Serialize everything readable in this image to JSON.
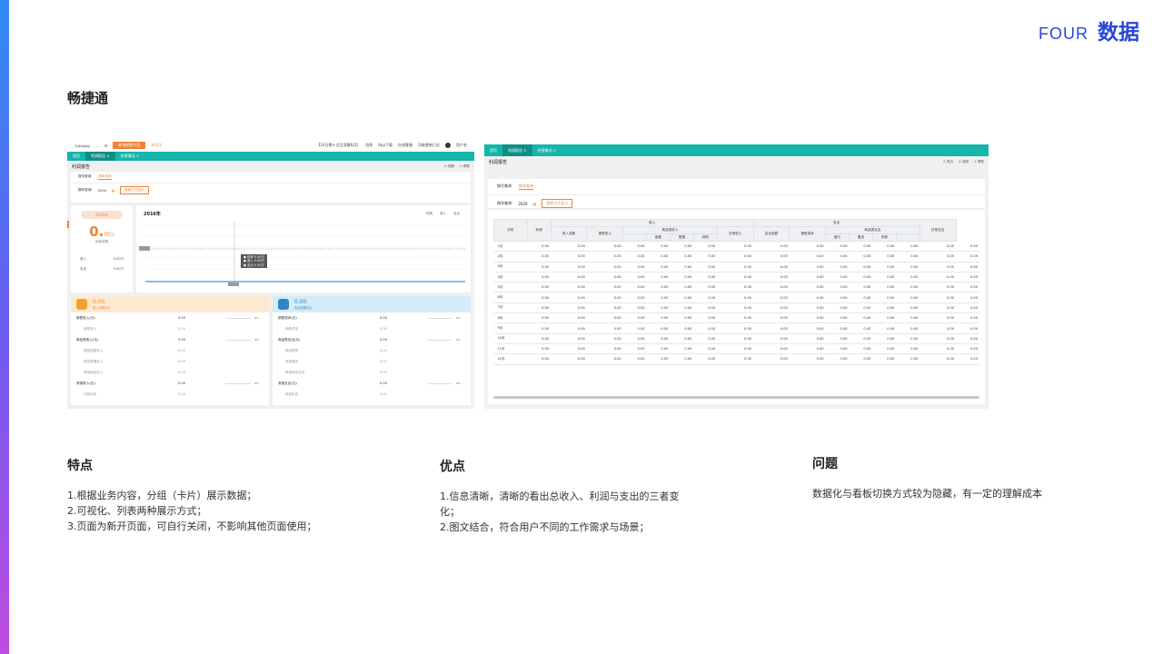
{
  "section": {
    "number": "FOUR",
    "title": "数据"
  },
  "product_name": "畅捷通",
  "shot1": {
    "topbar": {
      "company": "Tplink(tw)",
      "orange_button": "新增经营方案",
      "link": "本位企",
      "items": [
        "【24日晚十点至凌晨6点】",
        "消息",
        "App下载",
        "在线客服",
        "功能更新日志"
      ],
      "user": "用户名"
    },
    "tabs": [
      "首页",
      "利润报告 ×",
      "经营情况 ×"
    ],
    "page_title": "利润报告",
    "tools": [
      "⊙ 视频",
      "⊙ 帮助"
    ],
    "subtabs": [
      "按月查询",
      "按年查询"
    ],
    "filter_label": "报年查询:",
    "filter_year": "2016",
    "filter_button": "表格方式显示",
    "summary": {
      "year_pill": "2016年",
      "value": "0.",
      "value_small": "00",
      "unit": "万",
      "label": "利润总额",
      "income_label": "收入",
      "income_value": "0.00万",
      "expense_label": "支出",
      "expense_value": "0.00万"
    },
    "chart": {
      "title": "2016年",
      "legend": [
        "利润",
        "收入",
        "支出"
      ],
      "tooltip": [
        "● 利润 0.00万",
        "● 收入 0.00万",
        "● 支出 0.00万"
      ]
    },
    "income_panel": {
      "value": "0.00",
      "sub": "收入总额(元)",
      "rows": [
        {
          "name": "销售收入(元)",
          "value": "0.00",
          "pct": "0%",
          "sub": false
        },
        {
          "name": "销售收入",
          "value": "0.00",
          "sub": true
        },
        {
          "name": "商品类收入(元)",
          "value": "0.00",
          "pct": "0%",
          "sub": false
        },
        {
          "name": "商品盘盈收入",
          "value": "0.00",
          "sub": true
        },
        {
          "name": "商品受赠收入",
          "value": "0.00",
          "sub": true
        },
        {
          "name": "其他商品收入",
          "value": "0.00",
          "sub": true
        },
        {
          "name": "其他收入(元)",
          "value": "0.00",
          "pct": "0%",
          "sub": false
        },
        {
          "name": "付款折扣",
          "value": "0.00",
          "sub": true
        }
      ]
    },
    "expense_panel": {
      "value": "0.00",
      "sub": "支出总额(元)",
      "rows": [
        {
          "name": "销售成本(元)",
          "value": "0.00",
          "pct": "0%",
          "sub": false
        },
        {
          "name": "销售成本",
          "value": "0.00",
          "sub": true
        },
        {
          "name": "商品类支出(元)",
          "value": "0.00",
          "pct": "0%",
          "sub": false
        },
        {
          "name": "商品报损",
          "value": "0.00",
          "sub": true
        },
        {
          "name": "商品赠出",
          "value": "0.00",
          "sub": true
        },
        {
          "name": "其他商品支出",
          "value": "0.00",
          "sub": true
        },
        {
          "name": "其他支出(元)",
          "value": "0.00",
          "pct": "0%",
          "sub": false
        },
        {
          "name": "收款折扣",
          "value": "0.00",
          "sub": true
        }
      ]
    }
  },
  "shot2": {
    "tabs": [
      "首页",
      "利润报告 ×",
      "经营情况 ×"
    ],
    "page_title": "利润报告",
    "tools": [
      "⊙ 导出",
      "⊙ 视频",
      "⊙ 帮助"
    ],
    "subtabs": [
      "按月查询",
      "按年查询"
    ],
    "filter_label": "按年查询:",
    "filter_year": "2020",
    "filter_button": "图表方式显示",
    "table": {
      "h_month": "月份",
      "h_profit": "利润",
      "h_income": "收入",
      "h_expense": "支出",
      "h_income_total": "收入总额",
      "h_sales_income": "销售收入",
      "h_goods_income": "商品类收入",
      "h_daily_income": "日常收入",
      "h_surplus": "盘盈",
      "h_gift_in": "受赠",
      "h_other": "其他",
      "h_expense_total": "支出总额",
      "h_sales_cost": "销售成本",
      "h_goods_expense": "商品类支出",
      "h_daily_expense": "日常支出",
      "h_loss": "盘亏",
      "h_gift_out": "赠送",
      "h_other2": "其他",
      "months": [
        "1月",
        "2月",
        "3月",
        "4月",
        "5月",
        "6月",
        "7月",
        "8月",
        "9月",
        "10月",
        "11月",
        "12月"
      ],
      "cell": "0.00"
    }
  },
  "features": {
    "title": "特点",
    "items": [
      "1.根据业务内容，分组（卡片）展示数据；",
      "2.可视化、列表两种展示方式；",
      "3.页面为新开页面，可自行关闭，不影响其他页面使用；"
    ]
  },
  "advantages": {
    "title": "优点",
    "items": [
      "1.信息清晰，清晰的看出总收入、利润与支出的三者变化；",
      "2.图文结合，符合用户不同的工作需求与场景；"
    ]
  },
  "problems": {
    "title": "问题",
    "items": [
      "数据化与看板切换方式较为隐藏，有一定的理解成本"
    ]
  },
  "colors": {
    "accent": "#2b47d6",
    "teal": "#14b5aa",
    "orange": "#f08234",
    "blue": "#2f86c8"
  }
}
